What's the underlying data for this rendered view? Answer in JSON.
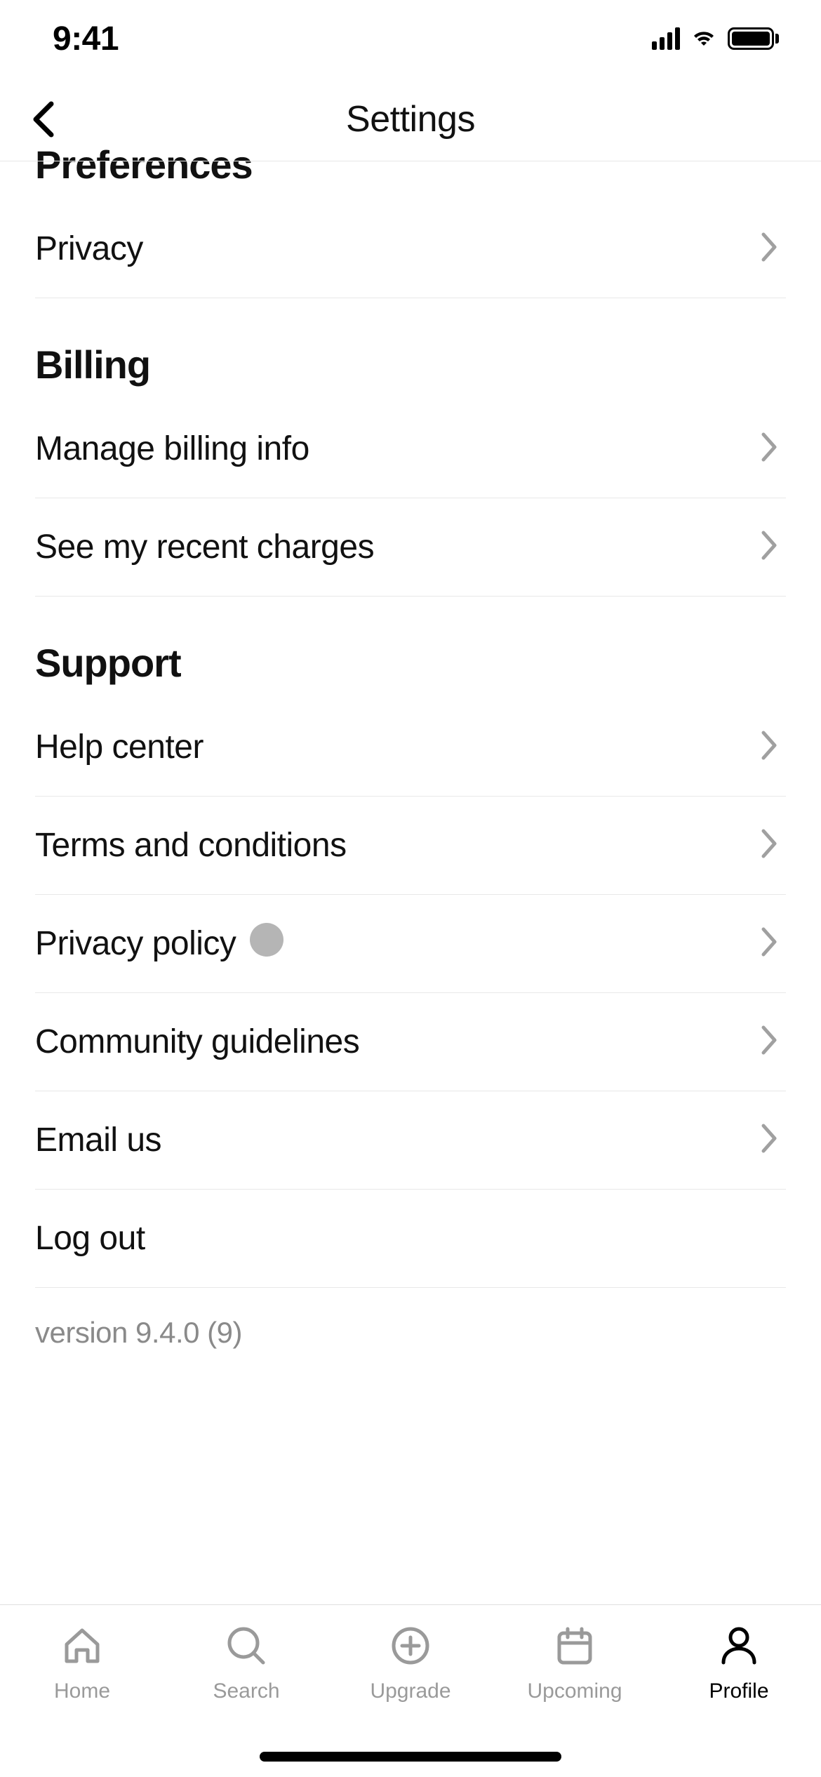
{
  "status": {
    "time": "9:41"
  },
  "header": {
    "title": "Settings"
  },
  "sections": {
    "preferences": {
      "title": "Preferences",
      "items": {
        "privacy": "Privacy"
      }
    },
    "billing": {
      "title": "Billing",
      "items": {
        "manage": "Manage billing info",
        "charges": "See my recent charges"
      }
    },
    "support": {
      "title": "Support",
      "items": {
        "help": "Help center",
        "terms": "Terms and conditions",
        "privacy_policy": "Privacy policy",
        "community": "Community guidelines",
        "email": "Email us",
        "logout": "Log out"
      }
    }
  },
  "version": "version 9.4.0 (9)",
  "tabs": {
    "home": "Home",
    "search": "Search",
    "upgrade": "Upgrade",
    "upcoming": "Upcoming",
    "profile": "Profile"
  }
}
